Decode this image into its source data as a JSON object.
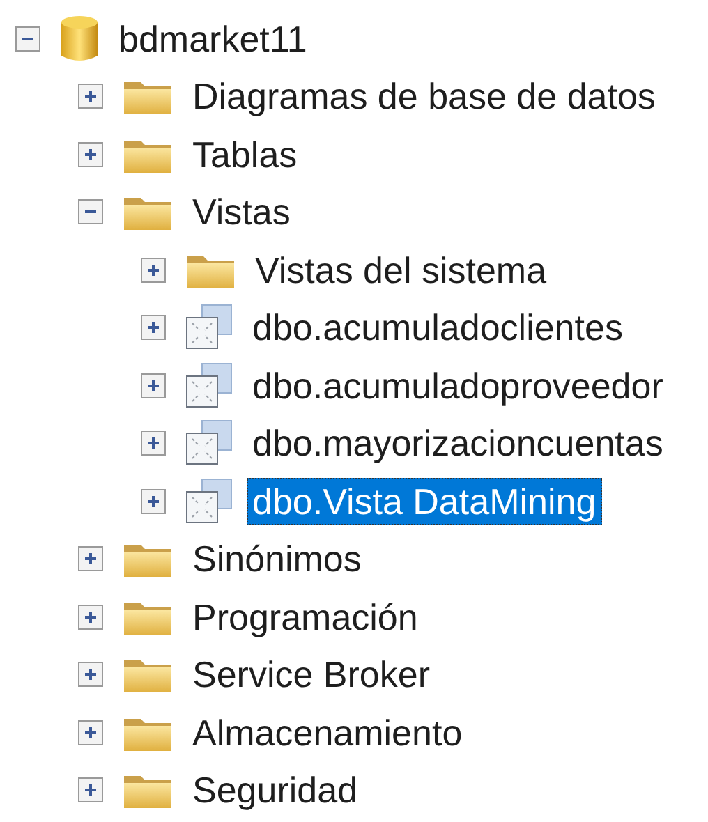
{
  "tree": [
    {
      "label": "bdmarket11",
      "kind": "database",
      "expanded": true,
      "selected": false,
      "children": [
        {
          "label": "Diagramas de base de datos",
          "kind": "folder",
          "expanded": false,
          "selected": false
        },
        {
          "label": "Tablas",
          "kind": "folder",
          "expanded": false,
          "selected": false
        },
        {
          "label": "Vistas",
          "kind": "folder",
          "expanded": true,
          "selected": false,
          "children": [
            {
              "label": "Vistas del sistema",
              "kind": "folder",
              "expanded": false,
              "selected": false
            },
            {
              "label": "dbo.acumuladoclientes",
              "kind": "view",
              "expanded": false,
              "selected": false
            },
            {
              "label": "dbo.acumuladoproveedor",
              "kind": "view",
              "expanded": false,
              "selected": false
            },
            {
              "label": "dbo.mayorizacioncuentas",
              "kind": "view",
              "expanded": false,
              "selected": false
            },
            {
              "label": "dbo.Vista DataMining",
              "kind": "view",
              "expanded": false,
              "selected": true
            }
          ]
        },
        {
          "label": "Sinónimos",
          "kind": "folder",
          "expanded": false,
          "selected": false
        },
        {
          "label": "Programación",
          "kind": "folder",
          "expanded": false,
          "selected": false
        },
        {
          "label": "Service Broker",
          "kind": "folder",
          "expanded": false,
          "selected": false
        },
        {
          "label": "Almacenamiento",
          "kind": "folder",
          "expanded": false,
          "selected": false
        },
        {
          "label": "Seguridad",
          "kind": "folder",
          "expanded": false,
          "selected": false
        }
      ]
    }
  ]
}
